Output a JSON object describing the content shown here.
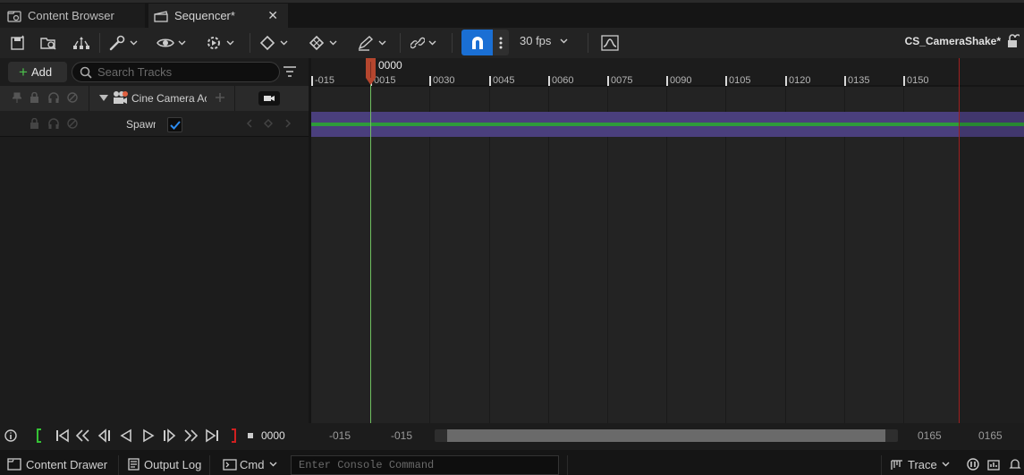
{
  "tabs": {
    "content_browser": "Content Browser",
    "sequencer": "Sequencer*",
    "close": "✕"
  },
  "toolbar": {
    "fps": "30 fps",
    "asset_name": "CS_CameraShake*"
  },
  "tracks_panel": {
    "add_label": "Add",
    "search_placeholder": "Search Tracks",
    "track_label": "Cine Camera Actor",
    "sub_track_label": "Spawned",
    "spawned_checked": true
  },
  "timeline": {
    "playhead_frame": "0000",
    "ticks": [
      "-015",
      "0015",
      "0030",
      "0045",
      "0060",
      "0075",
      "0090",
      "0105",
      "0120",
      "0135",
      "0150"
    ],
    "track_colors": {
      "band": "#4a3f7d",
      "key_line": "#2e9b3a",
      "playhead": "#70c060",
      "end_marker": "#a02020"
    }
  },
  "transport": {
    "current_frame": "0000",
    "view_start": "-015",
    "working_start": "-015",
    "working_end": "0165",
    "view_end": "0165"
  },
  "statusbar": {
    "content_drawer": "Content Drawer",
    "output_log": "Output Log",
    "cmd": "Cmd",
    "console_placeholder": "Enter Console Command",
    "trace": "Trace"
  }
}
